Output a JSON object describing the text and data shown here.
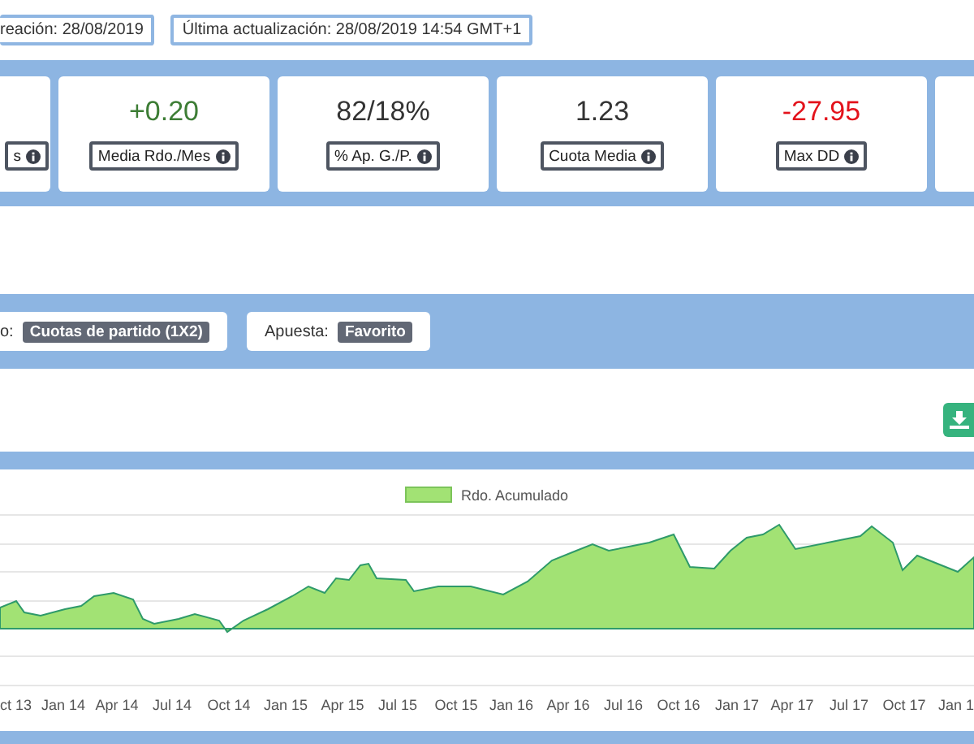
{
  "info_badges": [
    {
      "text": "reación: 28/08/2019"
    },
    {
      "text": "Última actualización: 28/08/2019 14:54 GMT+1"
    }
  ],
  "stats": [
    {
      "kind": "stat",
      "label": "s"
    },
    {
      "kind": "stat",
      "value": "+0.20",
      "color": "#3d7d35",
      "label": "Media Rdo./Mes"
    },
    {
      "kind": "stat",
      "value": "82/18%",
      "color": "#333333",
      "label": "% Ap. G./P."
    },
    {
      "kind": "stat",
      "value": "1.23",
      "color": "#333333",
      "label": "Cuota Media"
    },
    {
      "kind": "stat",
      "value": "-27.95",
      "color": "#e3121b",
      "label": "Max DD"
    },
    {
      "kind": "empty"
    }
  ],
  "filters": [
    {
      "label": "o:",
      "value": "Cuotas de partido (1X2)"
    },
    {
      "label": "Apuesta:",
      "value": "Favorito"
    }
  ],
  "chart": {
    "legend": "Rdo. Acumulado",
    "x_labels": [
      "ct 13",
      "Jan 14",
      "Apr 14",
      "Jul 14",
      "Oct 14",
      "Jan 15",
      "Apr 15",
      "Jul 15",
      "Oct 15",
      "Jan 16",
      "Apr 16",
      "Jul 16",
      "Oct 16",
      "Jan 17",
      "Apr 17",
      "Jul 17",
      "Oct 17",
      "Jan 1"
    ]
  }
}
